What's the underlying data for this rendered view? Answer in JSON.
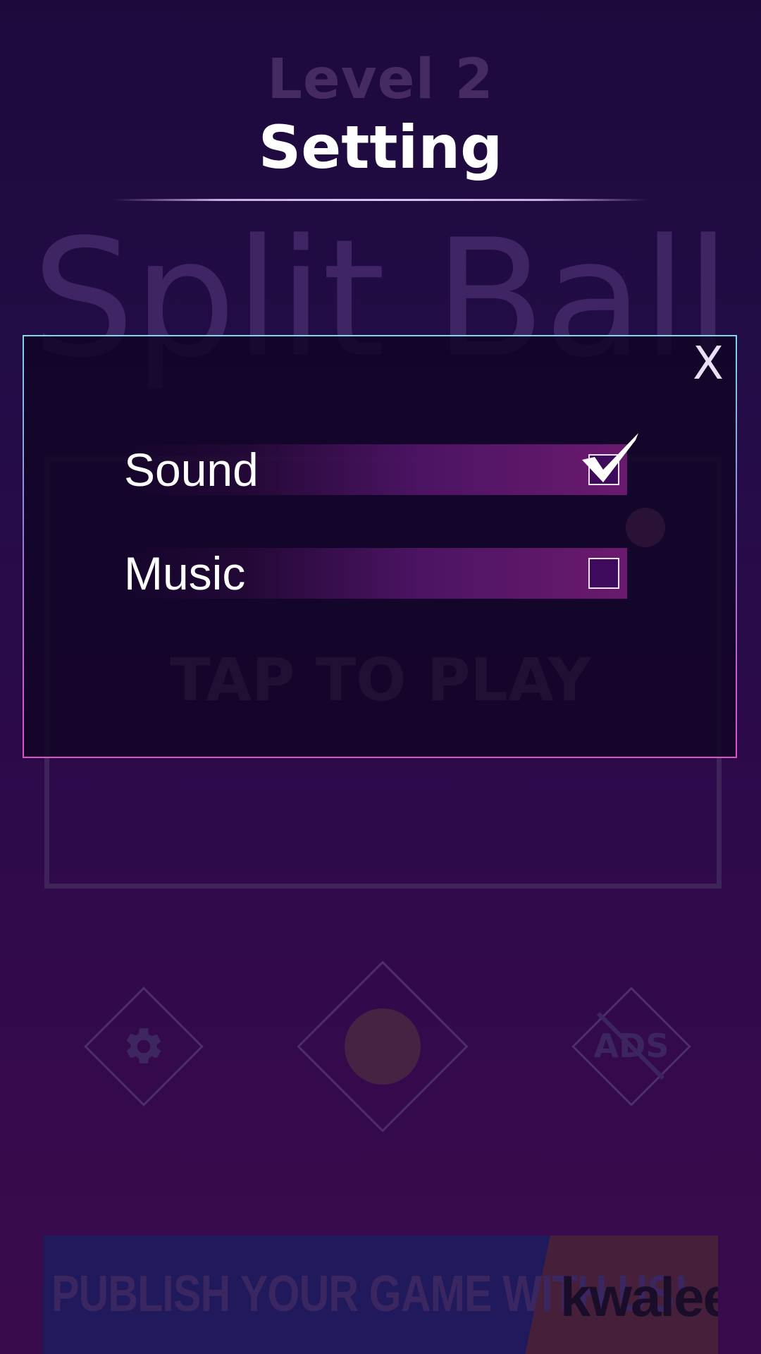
{
  "header": {
    "level_label": "Level 2",
    "screen_title": "Setting"
  },
  "background": {
    "logo_text": "Split Ball",
    "tap_to_play": "TAP TO PLAY"
  },
  "bottom_nav": {
    "settings_icon": "gear-icon",
    "play_icon": "ball-icon",
    "no_ads_label": "ADS"
  },
  "ad": {
    "text": "PUBLISH YOUR GAME WITH US!",
    "brand": "kwalee",
    "trademark": "™"
  },
  "settings_modal": {
    "close_label": "X",
    "options": [
      {
        "label": "Sound",
        "checked": true
      },
      {
        "label": "Music",
        "checked": false
      }
    ]
  },
  "colors": {
    "background_top": "#1d0a3d",
    "background_bottom": "#3a0b4c",
    "option_bar": "#6a1a6e",
    "modal_border_top": "#7fd7ea",
    "modal_border_bottom": "#e050c8"
  }
}
